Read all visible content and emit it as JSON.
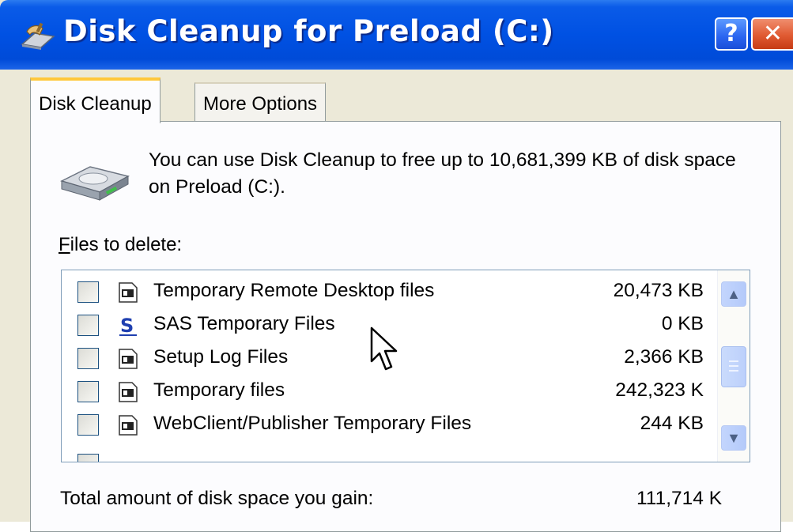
{
  "window": {
    "title": "Disk Cleanup for Preload (C:)",
    "help_button": "?",
    "close_button": "✕"
  },
  "tabs": [
    {
      "label": "Disk Cleanup",
      "active": true
    },
    {
      "label": "More Options",
      "active": false
    }
  ],
  "description": "You can use Disk Cleanup to free up to 10,681,399 KB of disk space on Preload (C:).",
  "files_label": {
    "mnemonic": "F",
    "rest": "iles to delete:"
  },
  "files": [
    {
      "name": "Temporary Remote Desktop files",
      "size": "20,473 KB",
      "checked": false,
      "icon": "file-icon"
    },
    {
      "name": "SAS Temporary Files",
      "size": "0 KB",
      "checked": false,
      "icon": "sas-logo-icon"
    },
    {
      "name": "Setup Log Files",
      "size": "2,366 KB",
      "checked": false,
      "icon": "file-icon"
    },
    {
      "name": "Temporary files",
      "size": "242,323 K",
      "checked": false,
      "icon": "file-icon"
    },
    {
      "name": "WebClient/Publisher Temporary Files",
      "size": "244 KB",
      "checked": false,
      "icon": "file-icon"
    }
  ],
  "total": {
    "label": "Total amount of disk space you gain:",
    "value": "111,714 K"
  },
  "colors": {
    "titlebar": "#0051e3",
    "dialog_bg": "#ece9d8",
    "active_tab_accent": "#ffc83c",
    "close_button": "#e05a32"
  }
}
